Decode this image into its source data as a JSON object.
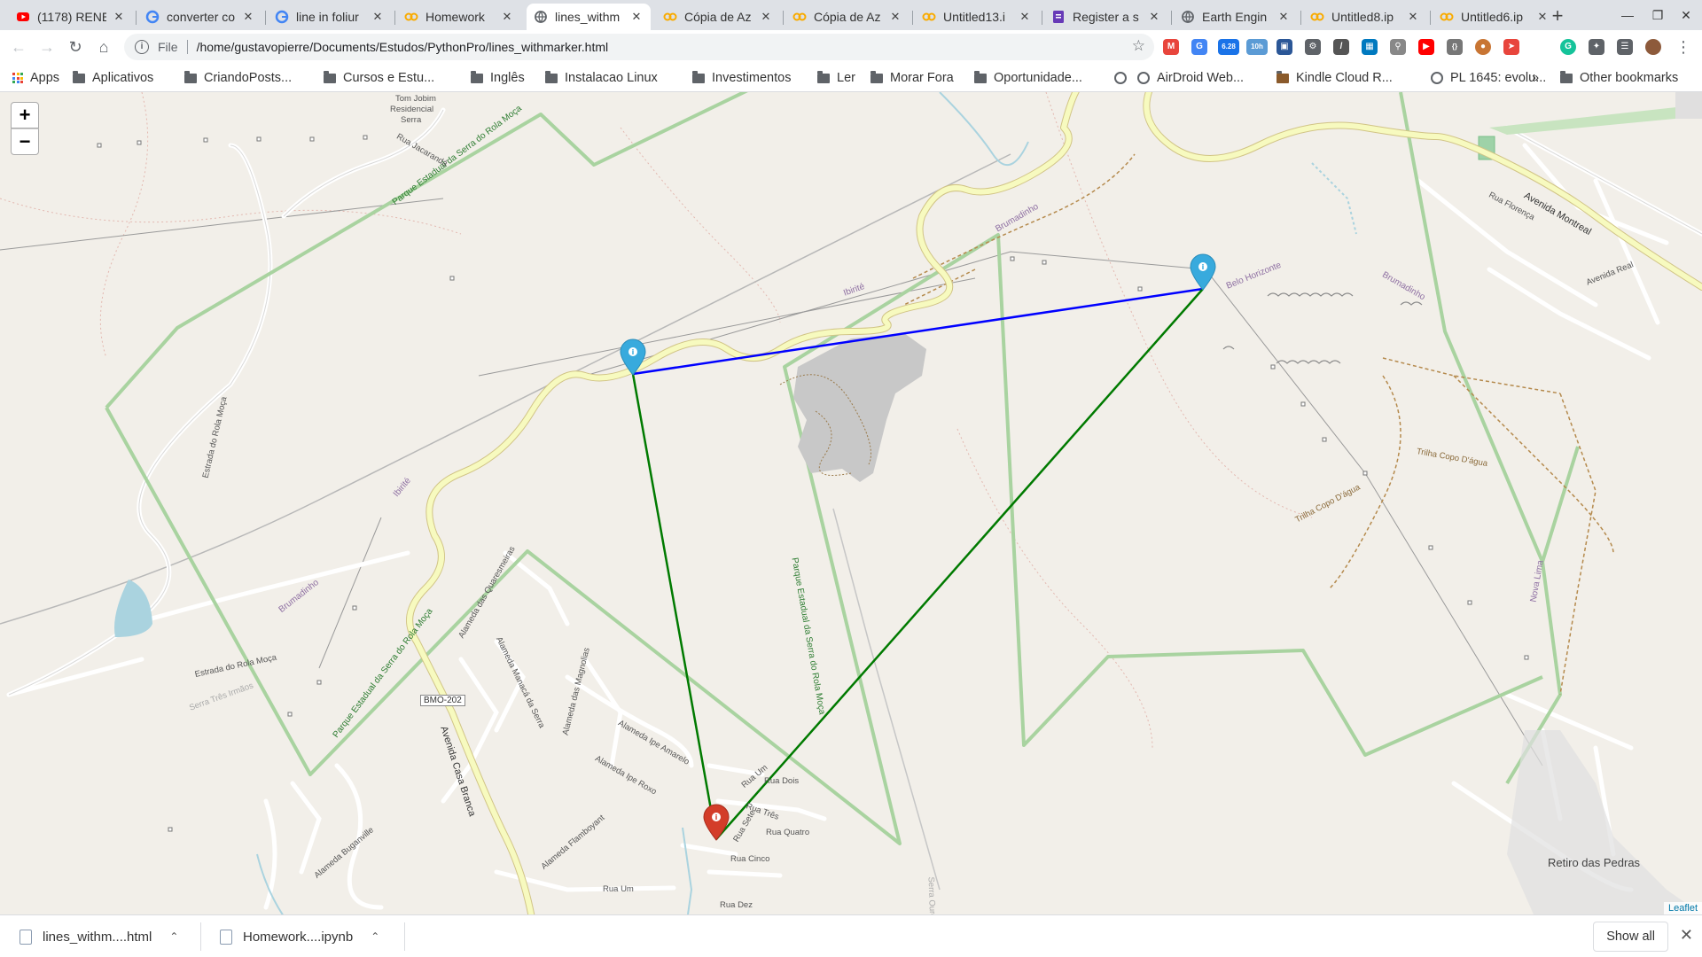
{
  "browser": {
    "tabs": [
      {
        "title": "(1178) RENE",
        "icon": "youtube-icon",
        "color": "#ff0000"
      },
      {
        "title": "converter co",
        "icon": "google-icon",
        "color": "#4285f4"
      },
      {
        "title": "line in foliur",
        "icon": "google-icon",
        "color": "#4285f4"
      },
      {
        "title": "Homework",
        "icon": "colab-icon",
        "color": "#f9ab00"
      },
      {
        "title": "lines_withm",
        "icon": "globe-icon",
        "color": "#5f6368"
      },
      {
        "title": "Cópia de Az",
        "icon": "colab-icon",
        "color": "#f9ab00"
      },
      {
        "title": "Cópia de Az",
        "icon": "colab-icon",
        "color": "#f9ab00"
      },
      {
        "title": "Untitled13.i",
        "icon": "colab-icon",
        "color": "#f9ab00"
      },
      {
        "title": "Register a s",
        "icon": "forms-icon",
        "color": "#673ab7"
      },
      {
        "title": "Earth Engin",
        "icon": "earth-engine-icon",
        "color": "#5f6368"
      },
      {
        "title": "Untitled8.ip",
        "icon": "colab-icon",
        "color": "#f9ab00"
      },
      {
        "title": "Untitled6.ip",
        "icon": "colab-icon",
        "color": "#f9ab00"
      }
    ],
    "active_tab_index": 4,
    "address": {
      "scheme": "File",
      "url": "/home/gustavopierre/Documents/Estudos/PythonPro/lines_withmarker.html"
    },
    "extension_badges": {
      "badge1": "6.28",
      "badge2": "10h"
    },
    "bookmarks": [
      {
        "label": "Apps",
        "type": "apps"
      },
      {
        "label": "Aplicativos",
        "type": "folder"
      },
      {
        "label": "CriandoPosts...",
        "type": "folder"
      },
      {
        "label": "Cursos e Estu...",
        "type": "folder"
      },
      {
        "label": "Inglês",
        "type": "folder"
      },
      {
        "label": "Instalacao Linux",
        "type": "folder"
      },
      {
        "label": "Investimentos",
        "type": "folder"
      },
      {
        "label": "Ler",
        "type": "folder"
      },
      {
        "label": "Morar Fora",
        "type": "folder"
      },
      {
        "label": "Oportunidade...",
        "type": "folder"
      },
      {
        "label": "",
        "type": "globe"
      },
      {
        "label": "AirDroid Web...",
        "type": "globe"
      },
      {
        "label": "Kindle Cloud R...",
        "type": "kindle"
      },
      {
        "label": "PL 1645: evolu...",
        "type": "globe"
      }
    ],
    "bookmarks_overflow": "»",
    "other_bookmarks": "Other bookmarks"
  },
  "map": {
    "zoom_in": "+",
    "zoom_out": "−",
    "attribution": "Leaflet",
    "colors": {
      "blue_line": "#0000ff",
      "green_line": "#007a00",
      "marker_blue": "#38aadd",
      "marker_red": "#d33d29",
      "park_border": "#a9d3a0",
      "road_yellow": "#f7fabf"
    },
    "labels": {
      "park1": "Parque Estadual da Serra do Rola Moça",
      "park2": "Parque Estadual da Serra do Rola Moça",
      "park3": "Parque Estadual da Serra do Rola Moça",
      "estrada_rola_moca": "Estrada do Rola Moça",
      "estrada_rola_moca2": "Estrada do Rola Moça",
      "ibirite1": "Ibirité",
      "ibirite2": "Ibirité",
      "brumadinho1": "Brumadinho",
      "brumadinho2": "Brumadinho",
      "brumadinho3": "Brumadinho",
      "belo_horizonte": "Belo Horizonte",
      "serra": "Serra",
      "tom_jobim": "Tom Jobim",
      "residencial": "Residencial",
      "serra_tres_irmaos": "Serra Três Irmãos",
      "serra_ouro_fino": "Serra Ouro Fino",
      "avenida_montreal": "Avenida Montreal",
      "avenida_casa_branca": "Avenida Casa Branca",
      "trilha1": "Trilha Copo D'água",
      "trilha2": "Trilha Copo D'água",
      "nova_lima": "Nova Lima",
      "retiro_das_pedras": "Retiro das Pedras",
      "bmo202": "BMO-202",
      "rua_um": "Rua Um",
      "rua_dois": "Rua Dois",
      "rua_tres": "Rua Três",
      "rua_quatro": "Rua Quatro",
      "rua_cinco": "Rua Cinco",
      "rua_sete": "Rua Sete",
      "rua_dez": "Rua Dez",
      "rua_um2": "Rua Um",
      "alameda_quaresmeiras": "Alameda das Quaresmeiras",
      "alameda_manaca": "Alameda Manacá da Serra",
      "alameda_magnolias": "Alameda das Magnolias",
      "alameda_ipe_amarelo": "Alameda Ipe Amarelo",
      "alameda_ipe_roxo": "Alameda Ipe Roxo",
      "alameda_flamboyant": "Alameda Flamboyant",
      "alameda_buganville": "Alameda Buganville",
      "rua_jacaranda": "Rua Jacarandá",
      "rua_florenca": "Rua Florença",
      "avenida_real": "Avenida Real"
    }
  },
  "downloads": {
    "items": [
      {
        "name": "lines_withm....html"
      },
      {
        "name": "Homework....ipynb"
      }
    ],
    "show_all": "Show all"
  }
}
